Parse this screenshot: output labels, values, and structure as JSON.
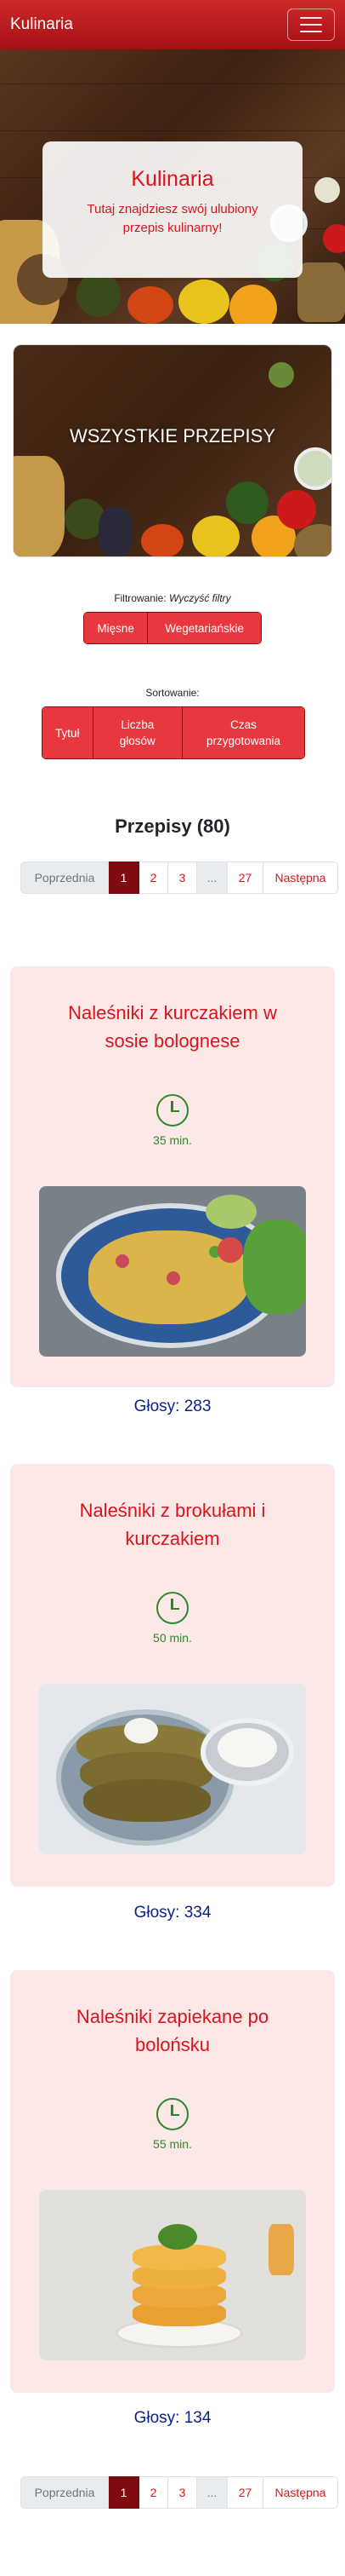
{
  "navbar": {
    "brand": "Kulinaria",
    "menu_icon": "hamburger-icon"
  },
  "hero": {
    "title": "Kulinaria",
    "subtitle": "Tutaj znajdziesz swój ulubiony przepis kulinarny!"
  },
  "category": {
    "title": "WSZYSTKIE PRZEPISY"
  },
  "filter": {
    "label": "Filtrowanie:",
    "clear": "Wyczyść filtry",
    "buttons": [
      "Mięsne",
      "Wegetariańskie"
    ]
  },
  "sort": {
    "label": "Sortowanie:",
    "buttons": [
      "Tytuł",
      "Liczba głosów",
      "Czas przygotowania"
    ]
  },
  "list": {
    "title": "Przepisy (80)"
  },
  "pagination": {
    "prev": "Poprzednia",
    "pages": [
      "1",
      "2",
      "3",
      "...",
      "27"
    ],
    "active": "1",
    "next": "Następna"
  },
  "recipes": [
    {
      "title": "Naleśniki z kurczakiem w sosie bolognese",
      "time": "35 min.",
      "votes": "Głosy: 283"
    },
    {
      "title": "Naleśniki z brokułami i kurczakiem",
      "time": "50 min.",
      "votes": "Głosy: 334"
    },
    {
      "title": "Naleśniki zapiekane po bolońsku",
      "time": "55 min.",
      "votes": "Głosy: 134"
    }
  ],
  "colors": {
    "primary": "#d9141e",
    "navbar": "#b8171c",
    "active_page": "#7f0a10",
    "card_bg": "#fde8e8",
    "time_green": "#2a8a2a",
    "votes_blue": "#0a1e8a"
  }
}
